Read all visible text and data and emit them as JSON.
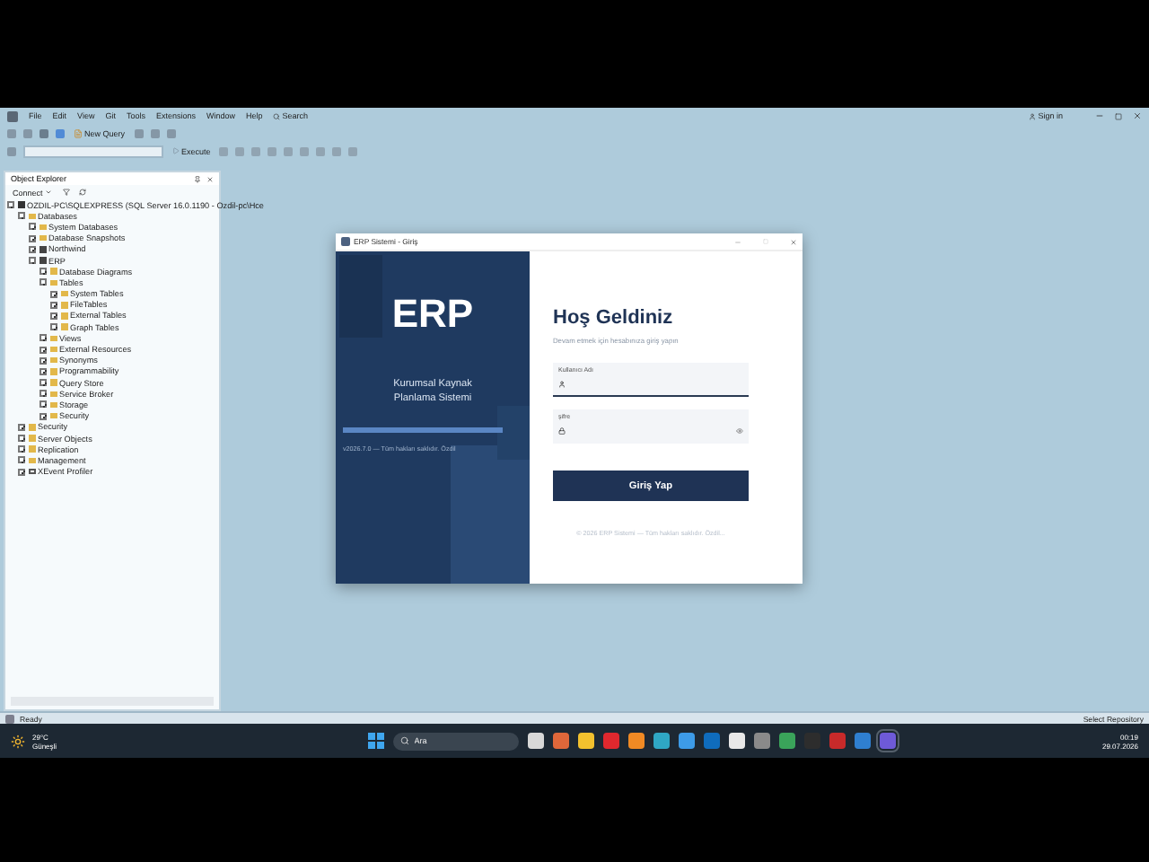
{
  "menu_bar": {
    "items": [
      "File",
      "Edit",
      "View",
      "Git",
      "Tools",
      "Extensions",
      "Window",
      "Help"
    ],
    "search": "Search",
    "sign_in": "Sign in"
  },
  "toolbar": {
    "new_query": "New Query",
    "execute": "Execute"
  },
  "object_explorer": {
    "title": "Object Explorer",
    "connect": "Connect",
    "tree": [
      {
        "label": "OZDIL-PC\\SQLEXPRESS (SQL Server 16.0.1190 - Ozdil-pc\\Hce",
        "kind": "server",
        "expanded": true,
        "children": [
          {
            "label": "Databases",
            "kind": "folder",
            "expanded": true,
            "children": [
              {
                "label": "System Databases",
                "kind": "folder",
                "expanded": false
              },
              {
                "label": "Database Snapshots",
                "kind": "folder",
                "expanded": false
              },
              {
                "label": "Northwind",
                "kind": "database",
                "expanded": false
              },
              {
                "label": "ERP",
                "kind": "database",
                "expanded": true,
                "children": [
                  {
                    "label": "Database Diagrams",
                    "kind": "folder",
                    "expanded": false
                  },
                  {
                    "label": "Tables",
                    "kind": "folder",
                    "expanded": true,
                    "children": [
                      {
                        "label": "System Tables",
                        "kind": "folder",
                        "expanded": false
                      },
                      {
                        "label": "FileTables",
                        "kind": "folder",
                        "expanded": false
                      },
                      {
                        "label": "External Tables",
                        "kind": "folder",
                        "expanded": false
                      },
                      {
                        "label": "Graph Tables",
                        "kind": "folder",
                        "expanded": false
                      }
                    ]
                  },
                  {
                    "label": "Views",
                    "kind": "folder",
                    "expanded": false
                  },
                  {
                    "label": "External Resources",
                    "kind": "folder",
                    "expanded": false
                  },
                  {
                    "label": "Synonyms",
                    "kind": "folder",
                    "expanded": false
                  },
                  {
                    "label": "Programmability",
                    "kind": "folder",
                    "expanded": false
                  },
                  {
                    "label": "Query Store",
                    "kind": "folder",
                    "expanded": false
                  },
                  {
                    "label": "Service Broker",
                    "kind": "folder",
                    "expanded": false
                  },
                  {
                    "label": "Storage",
                    "kind": "folder",
                    "expanded": false
                  },
                  {
                    "label": "Security",
                    "kind": "folder",
                    "expanded": false
                  }
                ]
              }
            ]
          },
          {
            "label": "Security",
            "kind": "folder",
            "expanded": false
          },
          {
            "label": "Server Objects",
            "kind": "folder",
            "expanded": false
          },
          {
            "label": "Replication",
            "kind": "folder",
            "expanded": false
          },
          {
            "label": "Management",
            "kind": "folder",
            "expanded": false
          },
          {
            "label": "XEvent Profiler",
            "kind": "profiler",
            "expanded": false
          }
        ]
      }
    ]
  },
  "login_window": {
    "title": "ERP Sistemi - Giriş",
    "logo": "ERP",
    "tagline": "Kurumsal Kaynak Planlama Sistemi",
    "progress": {
      "level": 1
    },
    "version": "v2026.7.0 — Tüm hakları saklıdır. Özdil",
    "heading": "Hoş Geldiniz",
    "subheading": "Devam etmek için hesabınıza giriş yapın",
    "fields": [
      {
        "kind": "text",
        "label": "Kullanıcı Adı"
      },
      {
        "kind": "password",
        "label": "şifre"
      }
    ],
    "button": "Giriş Yap",
    "footer": "© 2026 ERP Sistemi — Tüm hakları saklıdır. Özdil..."
  },
  "status_bar": {
    "text": "Ready",
    "repository": "Select Repository"
  },
  "taskbar": {
    "temperature": "29°C",
    "weather": "Güneşli",
    "search_placeholder": "Ara",
    "time": "00:19",
    "date": "29.07.2026",
    "apps": [
      {
        "color": "#d8d8d8",
        "selected": false
      },
      {
        "color": "#e0673a",
        "selected": false
      },
      {
        "color": "#f2c12e",
        "selected": false
      },
      {
        "color": "#e0282e",
        "selected": false
      },
      {
        "color": "#f08a24",
        "selected": false
      },
      {
        "color": "#2fa7c4",
        "selected": false
      },
      {
        "color": "#3d9be8",
        "selected": false
      },
      {
        "color": "#0f6cbd",
        "selected": false
      },
      {
        "color": "#e8e8e8",
        "selected": false
      },
      {
        "color": "#8a8a8a",
        "selected": false
      },
      {
        "color": "#3aa35a",
        "selected": false
      },
      {
        "color": "#2d2d2d",
        "selected": false
      },
      {
        "color": "#c82a2a",
        "selected": false
      },
      {
        "color": "#2f7fd0",
        "selected": false
      },
      {
        "color": "#6e5ad8",
        "selected": true
      }
    ]
  }
}
